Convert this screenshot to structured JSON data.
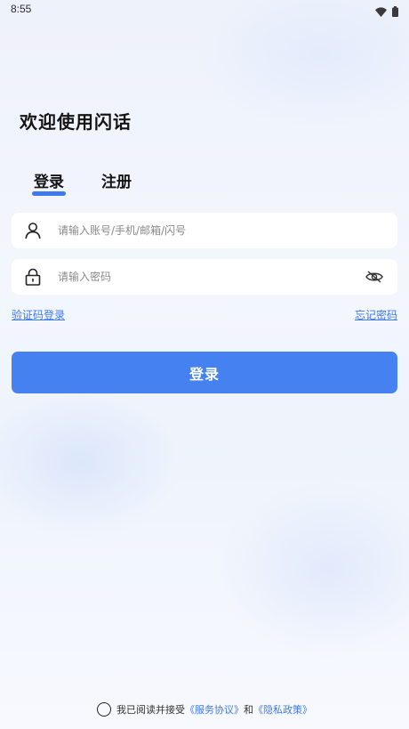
{
  "status_bar": {
    "time": "8:55",
    "icons": [
      "wifi-icon",
      "battery-icon"
    ]
  },
  "welcome_title": "欢迎使用闪话",
  "tabs": [
    {
      "label": "登录",
      "active": true
    },
    {
      "label": "注册",
      "active": false
    }
  ],
  "account_input": {
    "icon": "user-icon",
    "placeholder": "请输入账号/手机/邮箱/闪号",
    "value": ""
  },
  "password_input": {
    "icon": "lock-icon",
    "placeholder": "请输入密码",
    "value": "",
    "toggle_icon": "eye-hidden-icon"
  },
  "links": {
    "sms_login": "验证码登录",
    "forgot_password": "忘记密码"
  },
  "login_button": "登录",
  "agreement": {
    "prefix": "我已阅读并接受",
    "service": "《服务协议》",
    "joiner": "和",
    "privacy": "《隐私政策》",
    "checked": false
  },
  "colors": {
    "accent": "#4581f1",
    "link": "#3f79ee",
    "text": "#141414"
  }
}
